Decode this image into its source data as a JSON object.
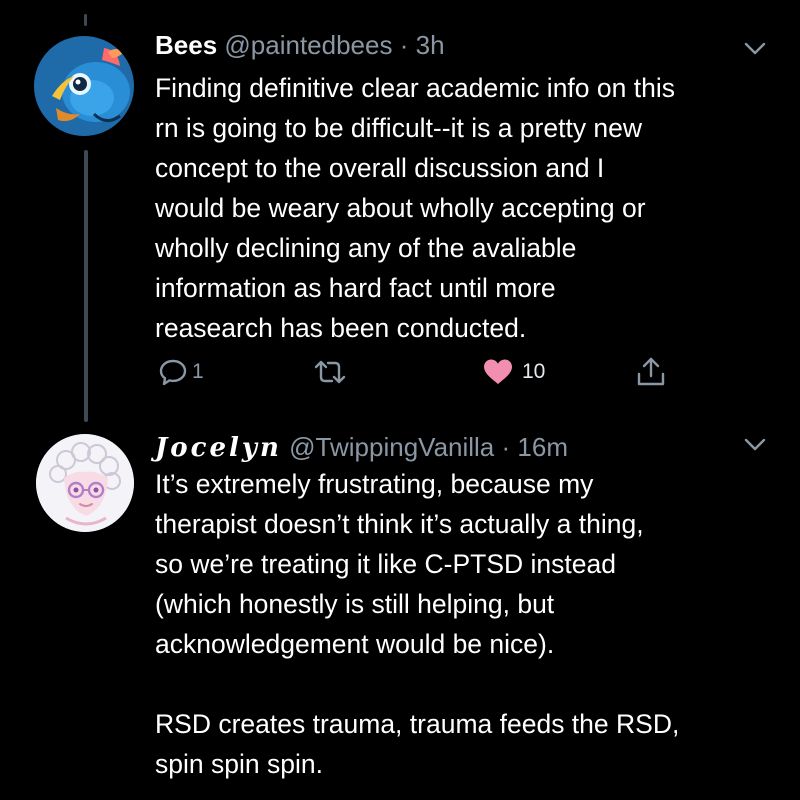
{
  "tweets": [
    {
      "display_name": "Bees",
      "handle": "@paintedbees",
      "separator": "·",
      "time": "3h",
      "body_lines": [
        "Finding definitive clear academic info on this",
        "rn is going to be difficult--it is a pretty new",
        "concept to the overall discussion and I",
        "would be weary about wholly accepting or",
        "wholly declining any of the avaliable",
        "information as hard fact until more",
        "reasearch has been conducted."
      ],
      "actions": {
        "reply_icon": "comment-icon",
        "reply_count": "1",
        "retweet_icon": "retweet-icon",
        "like_icon": "heart-filled-icon",
        "like_count": "10",
        "share_icon": "share-icon"
      }
    },
    {
      "display_name": "Jocelyn",
      "handle": "@TwippingVanilla",
      "separator": "·",
      "time": "16m",
      "body_paragraphs": [
        [
          "It’s extremely frustrating, because my",
          "therapist doesn’t think it’s actually a thing,",
          "so we’re treating it like C-PTSD instead",
          "(which honestly is still helping, but",
          "acknowledgement would be nice)."
        ],
        [
          "RSD creates trauma, trauma feeds the RSD,",
          "spin spin spin."
        ]
      ]
    }
  ],
  "colors": {
    "background": "#000000",
    "text": "#ffffff",
    "muted": "#8a97a4",
    "thread_line": "#3d4a55",
    "like": "#f28fb0"
  }
}
